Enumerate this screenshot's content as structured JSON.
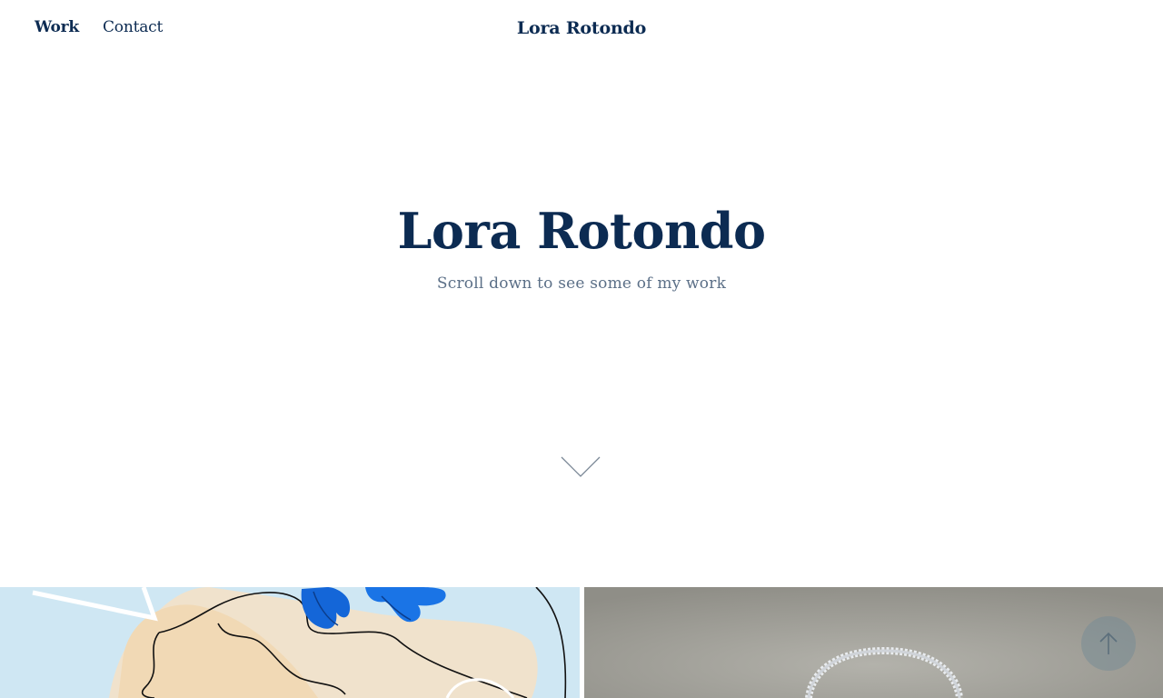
{
  "nav": {
    "work_label": "Work",
    "contact_label": "Contact"
  },
  "header": {
    "site_title": "Lora Rotondo"
  },
  "hero": {
    "title": "Lora Rotondo",
    "subtitle": "Scroll down to see some of my work"
  },
  "icons": {
    "scroll": "chevron-down-icon",
    "back_to_top": "arrow-up-icon"
  },
  "colors": {
    "brand_navy": "#0c2b52",
    "subtitle_gray": "#5b6f87",
    "tile_left_bg": "#cfe7f3",
    "tile_right_bg": "#9c9b94",
    "butterfly_blue": "#1466d8"
  }
}
